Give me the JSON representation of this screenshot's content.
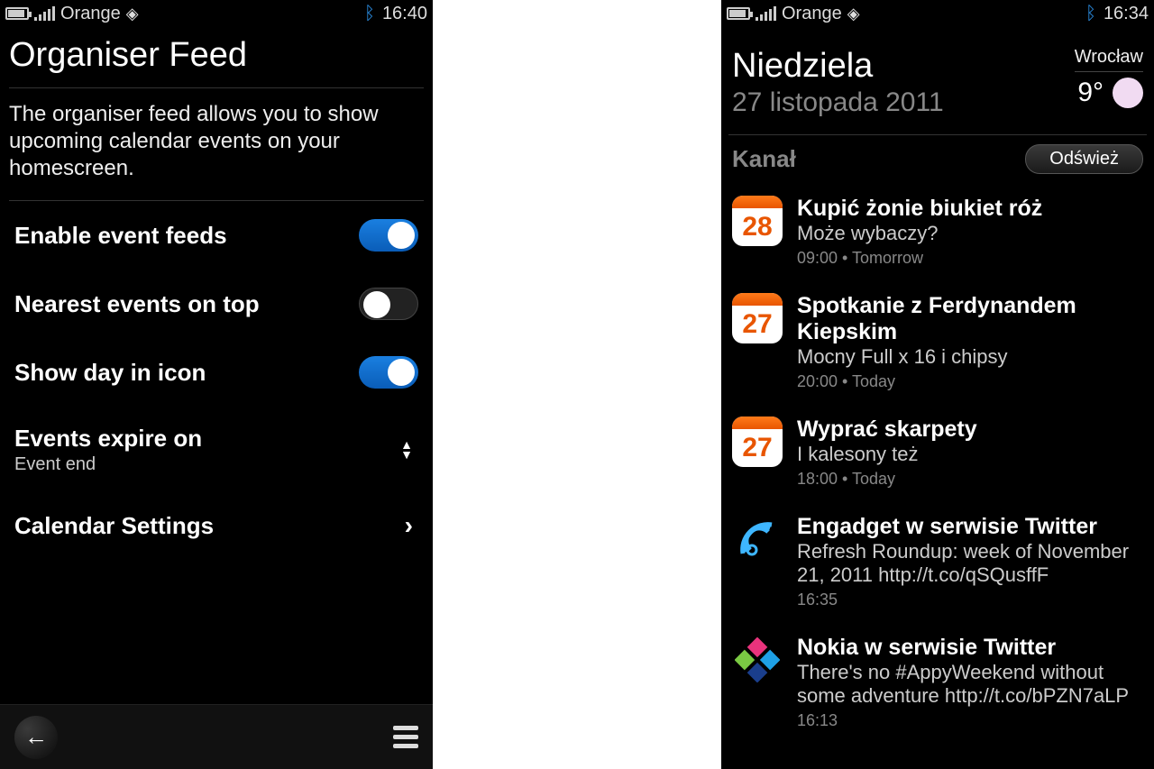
{
  "left": {
    "status": {
      "carrier": "Orange",
      "time": "16:40"
    },
    "title": "Organiser Feed",
    "description": "The organiser feed allows you to show upcoming calendar events on your homescreen.",
    "settings": {
      "enable_feeds": {
        "label": "Enable event feeds",
        "on": true
      },
      "nearest_on_top": {
        "label": "Nearest events on top",
        "on": false
      },
      "show_day_icon": {
        "label": "Show day in icon",
        "on": true
      },
      "expire": {
        "label": "Events expire on",
        "value": "Event end"
      },
      "calendar_settings": {
        "label": "Calendar Settings"
      }
    }
  },
  "right": {
    "status": {
      "carrier": "Orange",
      "time": "16:34"
    },
    "header": {
      "day": "Niedziela",
      "date": "27 listopada 2011",
      "city": "Wrocław",
      "temperature": "9°"
    },
    "feed_label": "Kanał",
    "refresh": "Odśwież",
    "items": [
      {
        "icon": "cal",
        "day": "28",
        "title": "Kupić żonie biukiet róż",
        "subtitle": "Może wybaczy?",
        "meta": "09:00 • Tomorrow"
      },
      {
        "icon": "cal",
        "day": "27",
        "title": "Spotkanie z Ferdynandem Kiepskim",
        "subtitle": "Mocny Full x 16 i chipsy",
        "meta": "20:00 • Today"
      },
      {
        "icon": "cal",
        "day": "27",
        "title": "Wyprać skarpety",
        "subtitle": "I kalesony też",
        "meta": "18:00 • Today"
      },
      {
        "icon": "engadget",
        "title": "Engadget w serwisie Twitter",
        "subtitle": "Refresh Roundup: week of November 21, 2011 http://t.co/qSQusffF",
        "meta": "16:35"
      },
      {
        "icon": "nokia",
        "title": "Nokia w serwisie Twitter",
        "subtitle": "There's no #AppyWeekend without some adventure http://t.co/bPZN7aLP",
        "meta": "16:13"
      }
    ]
  }
}
